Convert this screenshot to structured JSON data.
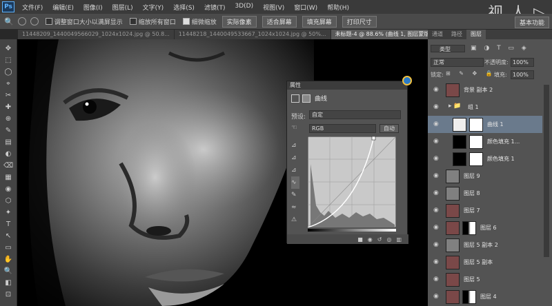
{
  "app": {
    "logo": "Ps",
    "watermark": "视 人 ▷"
  },
  "menu": [
    "文件(F)",
    "编辑(E)",
    "图像(I)",
    "图层(L)",
    "文字(Y)",
    "选择(S)",
    "滤镜(T)",
    "3D(D)",
    "视图(V)",
    "窗口(W)",
    "帮助(H)"
  ],
  "options": {
    "check1": "调整窗口大小以满屏显示",
    "check2": "缩放所有窗口",
    "check3": "细微缩放",
    "btn1": "实际像素",
    "btn2": "适合屏幕",
    "btn3": "填充屏幕",
    "btn4": "打印尺寸",
    "workspace": "基本功能"
  },
  "tabs": [
    "11448209_1440049566029_1024x1024.jpg @ 50.8...",
    "11448218_1440049533667_1024x1024.jpg @ 50%...",
    "未标题-4 @ 88.6% (曲线 1, 图层蒙版/8) *"
  ],
  "properties": {
    "title": "属性",
    "panel_name": "曲线",
    "preset_label": "预设:",
    "preset_value": "自定",
    "channel": "RGB",
    "auto": "自动"
  },
  "right_panel": {
    "tabs": [
      "通道",
      "路径",
      "图层"
    ],
    "kind": "类型",
    "blend": "正常",
    "opacity_label": "不透明度:",
    "opacity": "100%",
    "lock_label": "锁定:",
    "fill_label": "填充:",
    "fill": "100%",
    "layers": [
      {
        "name": "背景 副本 2",
        "type": "face"
      },
      {
        "name": "组 1",
        "type": "group"
      },
      {
        "name": "曲线 1",
        "type": "curves",
        "selected": true
      },
      {
        "name": "颜色填充 1...",
        "type": "fill"
      },
      {
        "name": "颜色填充 1",
        "type": "fill"
      },
      {
        "name": "图层 9",
        "type": "gray"
      },
      {
        "name": "图层 8",
        "type": "gray"
      },
      {
        "name": "图层 7",
        "type": "face"
      },
      {
        "name": "图层 6",
        "type": "facemask"
      },
      {
        "name": "图层 5 副本 2",
        "type": "gray"
      },
      {
        "name": "图层 5 副本",
        "type": "face"
      },
      {
        "name": "图层 5",
        "type": "face"
      },
      {
        "name": "图层 4",
        "type": "facemask"
      }
    ]
  },
  "colors": {
    "menubar": "#3a3a3a",
    "panel": "#535353",
    "selected_layer": "#6a7a8c"
  }
}
